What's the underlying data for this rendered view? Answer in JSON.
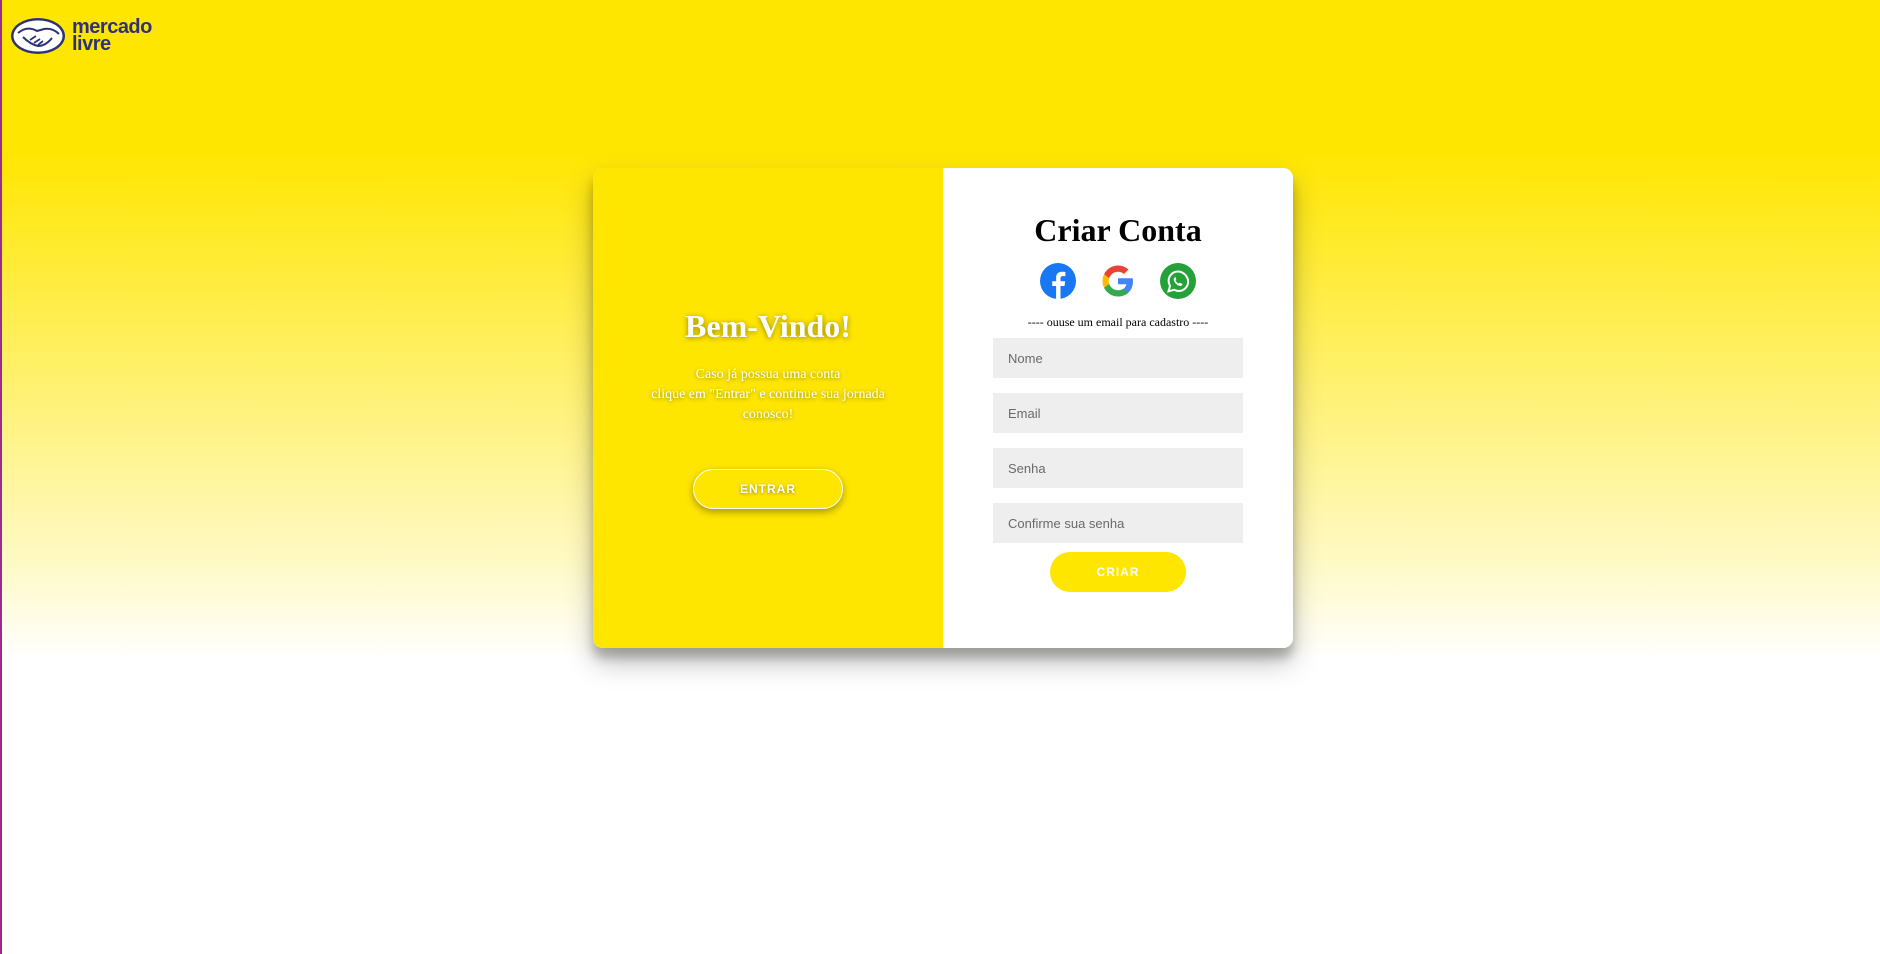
{
  "brand": {
    "name_line1": "mercado",
    "name_line2": "livre",
    "color": "#2d3277",
    "accent": "#ffe600"
  },
  "welcome": {
    "title": "Bem-Vindo!",
    "text": "Caso já possua uma conta\nclique em \"Entrar\" e continue sua jornada\nconosco!",
    "button_label": "ENTRAR"
  },
  "signup": {
    "title": "Criar Conta",
    "social": [
      {
        "name": "facebook",
        "icon": "facebook-icon",
        "color": "#1877f2"
      },
      {
        "name": "google",
        "icon": "google-icon"
      },
      {
        "name": "whatsapp",
        "icon": "whatsapp-icon",
        "color": "#25a13a"
      }
    ],
    "divider": "---- ouuse um email para cadastro ----",
    "fields": {
      "name_placeholder": "Nome",
      "email_placeholder": "Email",
      "password_placeholder": "Senha",
      "confirm_placeholder": "Confirme sua senha"
    },
    "button_label": "CRIAR"
  }
}
